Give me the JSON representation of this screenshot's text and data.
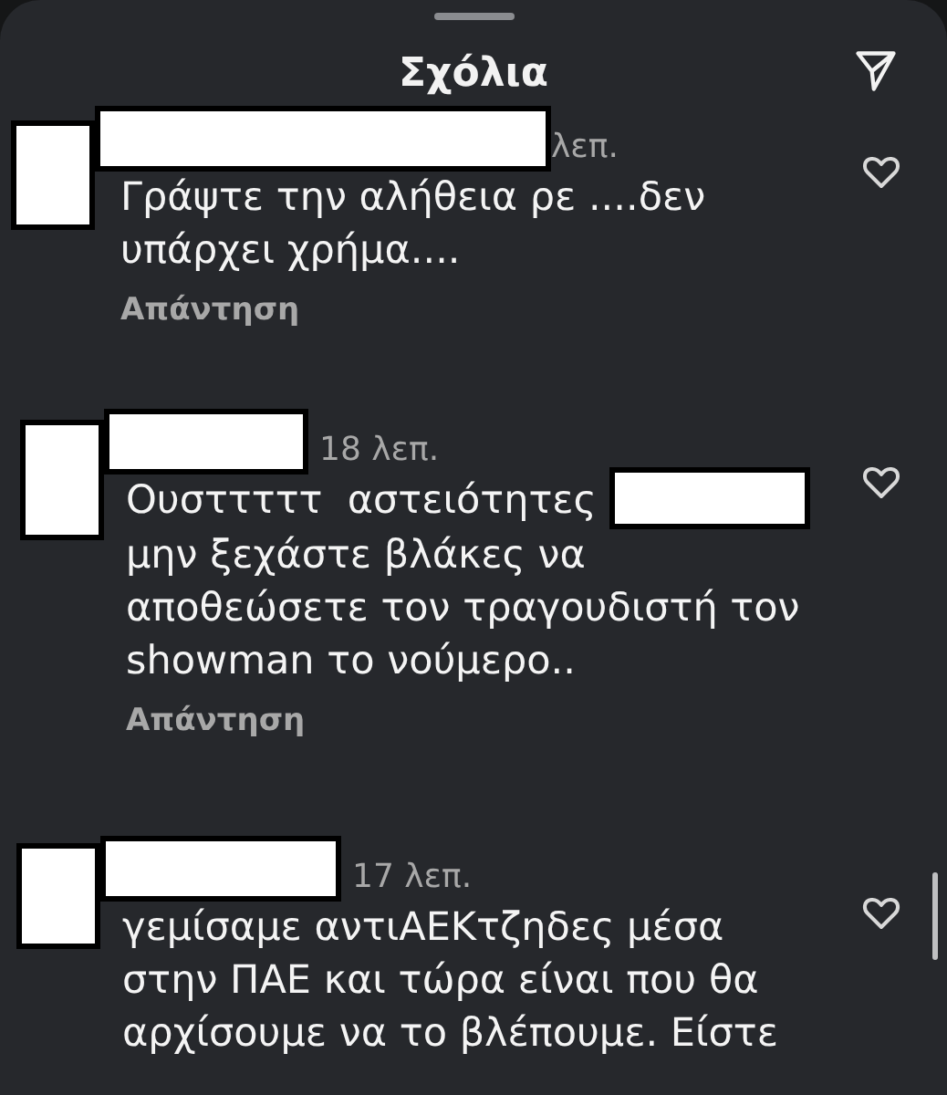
{
  "sheet": {
    "title": "Σχόλια"
  },
  "comments": [
    {
      "time": "λεπ.",
      "liked": false,
      "reply": "Απάντηση",
      "parts": [
        {
          "kind": "text",
          "text": "Γράψτε την αλήθεια ρε ....δεν υπάρχει χρήμα...."
        }
      ]
    },
    {
      "time": "18 λεπ.",
      "liked": false,
      "reply": "Απάντηση",
      "parts": [
        {
          "kind": "text",
          "text": "Ουστττττ  αστειότητες"
        },
        {
          "kind": "redaction"
        },
        {
          "kind": "text",
          "text": "μην ξεχάστε βλάκες να αποθεώσετε τον τραγουδιστή τον showman το νούμερο.."
        }
      ]
    },
    {
      "time": "17 λεπ.",
      "liked": false,
      "parts": [
        {
          "kind": "text",
          "text": "γεμίσαμε αντιΑΕΚτζηδες μέσα στην ΠΑΕ και τώρα είναι που θα αρχίσουμε να το βλέπουμε. Είστε"
        }
      ]
    }
  ]
}
